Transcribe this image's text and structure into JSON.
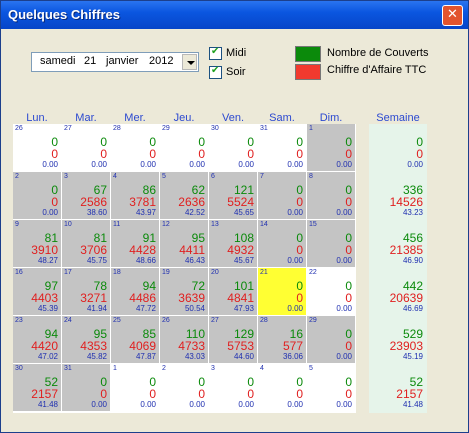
{
  "window": {
    "title": "Quelques Chiffres",
    "close_glyph": "✕"
  },
  "date": {
    "weekday": "samedi",
    "day": "21",
    "month": "janvier",
    "year": "2012"
  },
  "checkboxes": [
    {
      "label": "Midi",
      "checked": true
    },
    {
      "label": "Soir",
      "checked": true
    }
  ],
  "legend": [
    {
      "label": "Nombre de Couverts",
      "color": "#0b8a0b"
    },
    {
      "label": "Chiffre d'Affaire TTC",
      "color": "#f23a2e"
    }
  ],
  "day_headers": [
    "Lun.",
    "Mar.",
    "Mer.",
    "Jeu.",
    "Ven.",
    "Sam.",
    "Dim."
  ],
  "week_header": "Semaine",
  "colors": {
    "grey_cell": "#c4c4c4",
    "white_cell": "#ffffff",
    "today_cell": "#ffff33",
    "covers": "#0b8a0b",
    "revenue": "#e02020",
    "average": "#1f2fb0"
  },
  "weeks": [
    {
      "days": [
        {
          "d": "26",
          "c": "0",
          "r": "0",
          "a": "0.00",
          "s": "white"
        },
        {
          "d": "27",
          "c": "0",
          "r": "0",
          "a": "0.00",
          "s": "white"
        },
        {
          "d": "28",
          "c": "0",
          "r": "0",
          "a": "0.00",
          "s": "white"
        },
        {
          "d": "29",
          "c": "0",
          "r": "0",
          "a": "0.00",
          "s": "white"
        },
        {
          "d": "30",
          "c": "0",
          "r": "0",
          "a": "0.00",
          "s": "white"
        },
        {
          "d": "31",
          "c": "0",
          "r": "0",
          "a": "0.00",
          "s": "white"
        },
        {
          "d": "1",
          "c": "0",
          "r": "0",
          "a": "0.00",
          "s": "grey"
        }
      ],
      "total": {
        "c": "0",
        "r": "0",
        "a": "0.00"
      }
    },
    {
      "days": [
        {
          "d": "2",
          "c": "0",
          "r": "0",
          "a": "0.00",
          "s": "grey"
        },
        {
          "d": "3",
          "c": "67",
          "r": "2586",
          "a": "38.60",
          "s": "grey"
        },
        {
          "d": "4",
          "c": "86",
          "r": "3781",
          "a": "43.97",
          "s": "grey"
        },
        {
          "d": "5",
          "c": "62",
          "r": "2636",
          "a": "42.52",
          "s": "grey"
        },
        {
          "d": "6",
          "c": "121",
          "r": "5524",
          "a": "45.65",
          "s": "grey"
        },
        {
          "d": "7",
          "c": "0",
          "r": "0",
          "a": "0.00",
          "s": "grey"
        },
        {
          "d": "8",
          "c": "0",
          "r": "0",
          "a": "0.00",
          "s": "grey"
        }
      ],
      "total": {
        "c": "336",
        "r": "14526",
        "a": "43.23"
      }
    },
    {
      "days": [
        {
          "d": "9",
          "c": "81",
          "r": "3910",
          "a": "48.27",
          "s": "grey"
        },
        {
          "d": "10",
          "c": "81",
          "r": "3706",
          "a": "45.75",
          "s": "grey"
        },
        {
          "d": "11",
          "c": "91",
          "r": "4428",
          "a": "48.66",
          "s": "grey"
        },
        {
          "d": "12",
          "c": "95",
          "r": "4411",
          "a": "46.43",
          "s": "grey"
        },
        {
          "d": "13",
          "c": "108",
          "r": "4932",
          "a": "45.67",
          "s": "grey"
        },
        {
          "d": "14",
          "c": "0",
          "r": "0",
          "a": "0.00",
          "s": "grey"
        },
        {
          "d": "15",
          "c": "0",
          "r": "0",
          "a": "0.00",
          "s": "grey"
        }
      ],
      "total": {
        "c": "456",
        "r": "21385",
        "a": "46.90"
      }
    },
    {
      "days": [
        {
          "d": "16",
          "c": "97",
          "r": "4403",
          "a": "45.39",
          "s": "grey"
        },
        {
          "d": "17",
          "c": "78",
          "r": "3271",
          "a": "41.94",
          "s": "grey"
        },
        {
          "d": "18",
          "c": "94",
          "r": "4486",
          "a": "47.72",
          "s": "grey"
        },
        {
          "d": "19",
          "c": "72",
          "r": "3639",
          "a": "50.54",
          "s": "grey"
        },
        {
          "d": "20",
          "c": "101",
          "r": "4841",
          "a": "47.93",
          "s": "grey"
        },
        {
          "d": "21",
          "c": "0",
          "r": "0",
          "a": "0.00",
          "s": "today"
        },
        {
          "d": "22",
          "c": "0",
          "r": "0",
          "a": "0.00",
          "s": "white"
        }
      ],
      "total": {
        "c": "442",
        "r": "20639",
        "a": "46.69"
      }
    },
    {
      "days": [
        {
          "d": "23",
          "c": "94",
          "r": "4420",
          "a": "47.02",
          "s": "grey"
        },
        {
          "d": "24",
          "c": "95",
          "r": "4353",
          "a": "45.82",
          "s": "grey"
        },
        {
          "d": "25",
          "c": "85",
          "r": "4069",
          "a": "47.87",
          "s": "grey"
        },
        {
          "d": "26",
          "c": "110",
          "r": "4733",
          "a": "43.03",
          "s": "grey"
        },
        {
          "d": "27",
          "c": "129",
          "r": "5753",
          "a": "44.60",
          "s": "grey"
        },
        {
          "d": "28",
          "c": "16",
          "r": "577",
          "a": "36.06",
          "s": "grey"
        },
        {
          "d": "29",
          "c": "0",
          "r": "0",
          "a": "0.00",
          "s": "grey"
        }
      ],
      "total": {
        "c": "529",
        "r": "23903",
        "a": "45.19"
      }
    },
    {
      "days": [
        {
          "d": "30",
          "c": "52",
          "r": "2157",
          "a": "41.48",
          "s": "grey"
        },
        {
          "d": "31",
          "c": "0",
          "r": "0",
          "a": "0.00",
          "s": "grey"
        },
        {
          "d": "1",
          "c": "0",
          "r": "0",
          "a": "0.00",
          "s": "white"
        },
        {
          "d": "2",
          "c": "0",
          "r": "0",
          "a": "0.00",
          "s": "white"
        },
        {
          "d": "3",
          "c": "0",
          "r": "0",
          "a": "0.00",
          "s": "white"
        },
        {
          "d": "4",
          "c": "0",
          "r": "0",
          "a": "0.00",
          "s": "white"
        },
        {
          "d": "5",
          "c": "0",
          "r": "0",
          "a": "0.00",
          "s": "white"
        }
      ],
      "total": {
        "c": "52",
        "r": "2157",
        "a": "41.48"
      }
    }
  ]
}
